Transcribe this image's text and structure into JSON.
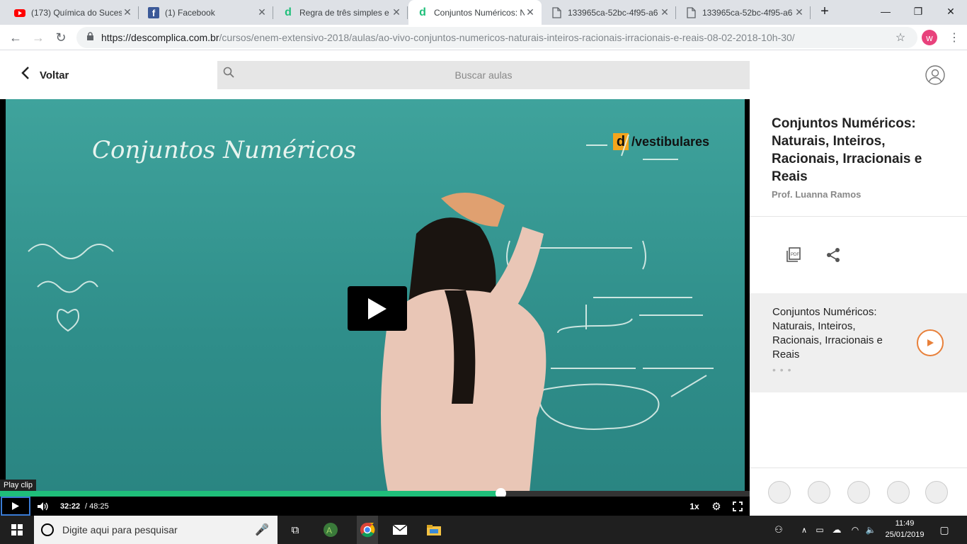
{
  "browser": {
    "tabs": [
      {
        "title": "(173) Química do Suces",
        "icon": "youtube-icon",
        "color": "#ff0000"
      },
      {
        "title": "(1) Facebook",
        "icon": "facebook-icon",
        "color": "#3b5998"
      },
      {
        "title": "Regra de três simples e",
        "icon": "descomplica-icon",
        "color": "#1fbf7a"
      },
      {
        "title": "Conjuntos Numéricos: N",
        "icon": "descomplica-icon",
        "color": "#1fbf7a"
      },
      {
        "title": "133965ca-52bc-4f95-a6",
        "icon": "document-icon",
        "color": "#5f6368"
      },
      {
        "title": "133965ca-52bc-4f95-a6",
        "icon": "document-icon",
        "color": "#5f6368"
      }
    ],
    "active_tab": 3,
    "url_host": "https://descomplica.com.br",
    "url_path": "/cursos/enem-extensivo-2018/aulas/ao-vivo-conjuntos-numericos-naturais-inteiros-racionais-irracionais-e-reais-08-02-2018-10h-30/",
    "profile_initial": "w",
    "profile_color": "#e8427c"
  },
  "header": {
    "back_label": "Voltar",
    "search_placeholder": "Buscar aulas"
  },
  "video": {
    "board_title": "Conjuntos Numéricos",
    "logo_text": "/vestibulares",
    "logo_letter": "d",
    "play_clip_label": "Play clip",
    "current_time": "32:22",
    "duration": "/ 48:25",
    "progress_fraction": 0.668,
    "speed": "1x",
    "accent": "#1fbf7a"
  },
  "panel": {
    "title": "Conjuntos Numéricos: Naturais, Inteiros, Racionais, Irracionais e Reais",
    "author": "Prof. Luanna Ramos",
    "lesson_title": "Conjuntos Numéricos: Naturais, Inteiros, Racionais, Irracionais e Reais",
    "lesson_dots": "• • •",
    "play_color": "#e8803a"
  },
  "taskbar": {
    "search_placeholder": "Digite aqui para pesquisar",
    "time": "11:49",
    "date": "25/01/2019"
  }
}
